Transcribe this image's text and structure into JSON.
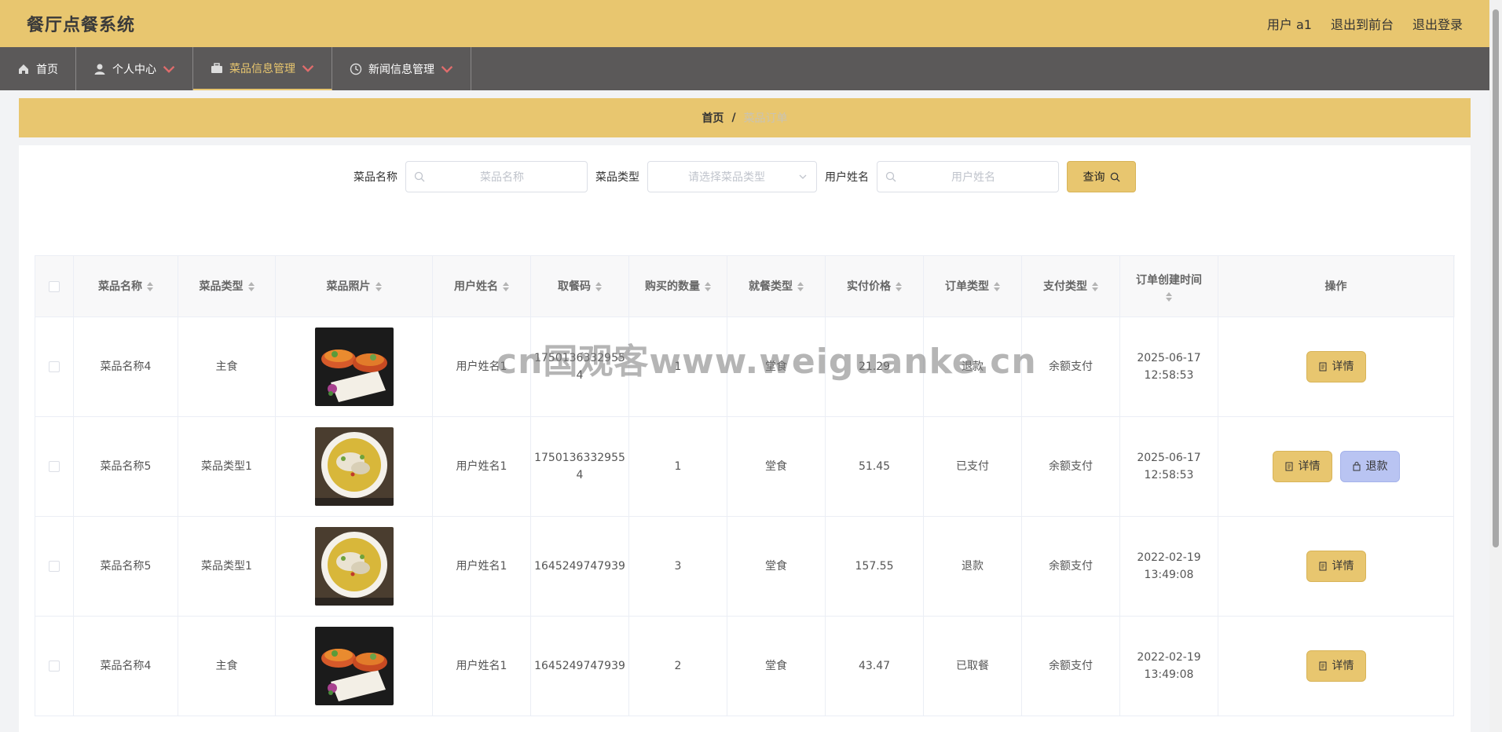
{
  "header": {
    "title": "餐厅点餐系统",
    "user_label": "用户 a1",
    "back_front_label": "退出到前台",
    "logout_label": "退出登录"
  },
  "nav": {
    "items": [
      {
        "label": "首页",
        "icon": "home-icon"
      },
      {
        "label": "个人中心",
        "icon": "user-icon"
      },
      {
        "label": "菜品信息管理",
        "icon": "briefcase-icon"
      },
      {
        "label": "新闻信息管理",
        "icon": "clock-icon"
      }
    ]
  },
  "breadcrumb": {
    "home": "首页",
    "separator": "/",
    "current": "菜品订单"
  },
  "filters": {
    "name_label": "菜品名称",
    "name_placeholder": "菜品名称",
    "type_label": "菜品类型",
    "type_placeholder": "请选择菜品类型",
    "user_label": "用户姓名",
    "user_placeholder": "用户姓名",
    "query_label": "查询"
  },
  "table": {
    "headers": [
      "菜品名称",
      "菜品类型",
      "菜品照片",
      "用户姓名",
      "取餐码",
      "购买的数量",
      "就餐类型",
      "实付价格",
      "订单类型",
      "支付类型",
      "订单创建时间",
      "操作"
    ],
    "rows": [
      {
        "name": "菜品名称4",
        "type": "主食",
        "image": "dish-bowls",
        "user": "用户姓名1",
        "code": "1750136332955 4",
        "qty": "1",
        "dine": "堂食",
        "price": "21.29",
        "order": "退款",
        "pay": "余额支付",
        "time": "2025-06-17 12:58:53",
        "refund": false
      },
      {
        "name": "菜品名称5",
        "type": "菜品类型1",
        "image": "dish-soup",
        "user": "用户姓名1",
        "code": "1750136332955 4",
        "qty": "1",
        "dine": "堂食",
        "price": "51.45",
        "order": "已支付",
        "pay": "余额支付",
        "time": "2025-06-17 12:58:53",
        "refund": true
      },
      {
        "name": "菜品名称5",
        "type": "菜品类型1",
        "image": "dish-soup",
        "user": "用户姓名1",
        "code": "1645249747939",
        "qty": "3",
        "dine": "堂食",
        "price": "157.55",
        "order": "退款",
        "pay": "余额支付",
        "time": "2022-02-19 13:49:08",
        "refund": false
      },
      {
        "name": "菜品名称4",
        "type": "主食",
        "image": "dish-bowls",
        "user": "用户姓名1",
        "code": "1645249747939",
        "qty": "2",
        "dine": "堂食",
        "price": "43.47",
        "order": "已取餐",
        "pay": "余额支付",
        "time": "2022-02-19 13:49:08",
        "refund": false
      }
    ],
    "detail_label": "详情",
    "refund_label": "退款"
  },
  "watermark": "cn国观客www.weiguanke.cn",
  "colors": {
    "accent": "#e8c66f",
    "nav_bg": "#5b5959",
    "refund_btn": "#b9c4f2"
  }
}
